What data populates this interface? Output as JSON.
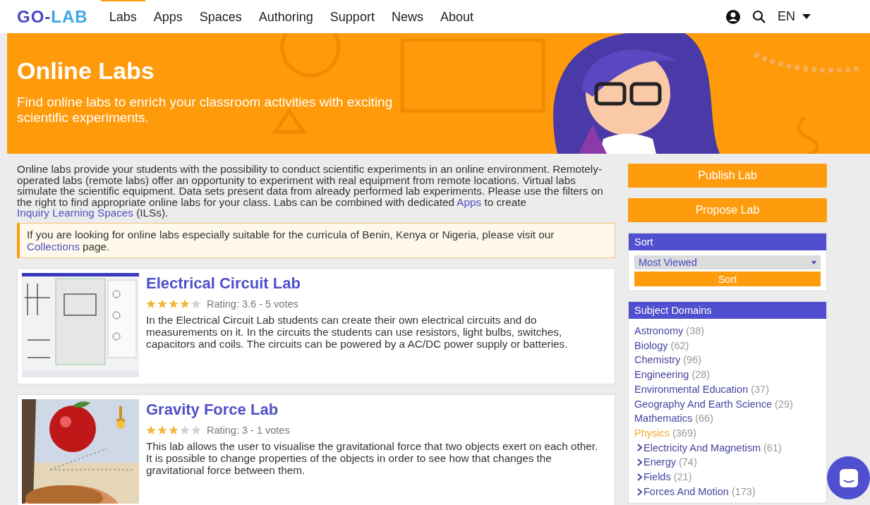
{
  "nav": {
    "logo": {
      "part_1": "GO-",
      "part_2": "LAB"
    },
    "items": [
      {
        "label": "Labs",
        "selected": true
      },
      {
        "label": "Apps",
        "selected": false
      },
      {
        "label": "Spaces",
        "selected": false
      },
      {
        "label": "Authoring",
        "selected": false
      },
      {
        "label": "Support",
        "selected": false
      },
      {
        "label": "News",
        "selected": false
      },
      {
        "label": "About",
        "selected": false
      }
    ],
    "language": "EN"
  },
  "banner": {
    "title": "Online Labs",
    "subtitle": "Find online labs to enrich your classroom activities with exciting scientific experiments."
  },
  "intro": [
    {
      "text": "Online labs provide your students with the possibility to conduct scientific experiments in an online environment. Remotely-operated labs (remote labs) offer an opportunity to experiment with real equipment from remote locations. Virtual labs simulate the scientific equipment. Data sets present data from already performed lab experiments. Please use the filters on the right to find appropriate online labs for your class. Labs can be combined with dedicated ",
      "link": false
    },
    {
      "text": "Apps",
      "link": true
    },
    {
      "text": " to create ",
      "link": false
    },
    {
      "text": "Inquiry Learning Spaces",
      "link": true
    },
    {
      "text": " (ILSs).",
      "link": false
    }
  ],
  "notice": [
    {
      "text": "If you are looking for online labs especially suitable for the curricula of Benin, Kenya or Nigeria, please visit our ",
      "link": false
    },
    {
      "text": "Collections",
      "link": true
    },
    {
      "text": " page.",
      "link": false
    }
  ],
  "labs": [
    {
      "title": "Electrical Circuit Lab",
      "stars": 4,
      "rating": "Rating: 3.6 - 5 votes",
      "description": "In the Electrical Circuit Lab students can create their own electrical circuits and do measurements on it. In the circuits the students can use resistors, light bulbs, switches, capacitors and coils. The circuits can be powered by a AC/DC power supply or batteries."
    },
    {
      "title": "Gravity Force Lab",
      "stars": 3,
      "rating": "Rating: 3 - 1 votes",
      "description": "This lab allows the user to visualise the gravitational force that two objects exert on each other. It is possible to change properties of the objects in order to see how that changes the gravitational force between them."
    }
  ],
  "actions": [
    "Publish Lab",
    "Propose Lab"
  ],
  "sort": {
    "title": "Sort",
    "value": "Most Viewed",
    "button": "Sort"
  },
  "subject_domains": {
    "title": "Subject Domains",
    "items": [
      {
        "name": "Astronomy",
        "count": "(38)",
        "selected": false
      },
      {
        "name": "Biology",
        "count": "(62)",
        "selected": false
      },
      {
        "name": "Chemistry",
        "count": "(96)",
        "selected": false
      },
      {
        "name": "Engineering",
        "count": "(28)",
        "selected": false
      },
      {
        "name": "Environmental Education",
        "count": "(37)",
        "selected": false
      },
      {
        "name": "Geography And Earth Science",
        "count": "(29)",
        "selected": false
      },
      {
        "name": "Mathematics",
        "count": "(66)",
        "selected": false
      },
      {
        "name": "Physics",
        "count": "(369)",
        "selected": true,
        "children": [
          {
            "name": "Electricity And Magnetism",
            "count": "(61)",
            "selected": false
          },
          {
            "name": "Energy",
            "count": "(74)",
            "selected": false
          },
          {
            "name": "Fields",
            "count": "(21)",
            "selected": false
          },
          {
            "name": "Forces And Motion",
            "count": "(173)",
            "selected": false
          }
        ]
      }
    ]
  }
}
